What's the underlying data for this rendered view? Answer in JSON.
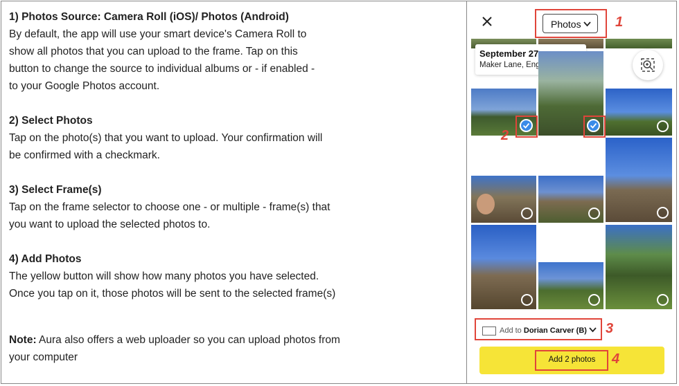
{
  "instructions": [
    {
      "title": "1) Photos Source: Camera Roll (iOS)/ Photos (Android)",
      "body": "By default, the app will use your smart device's Camera Roll to\nshow all photos that you can upload to the frame. Tap on this\nbutton to change the source to individual albums or - if enabled -\nto your Google Photos account."
    },
    {
      "title": "2) Select Photos",
      "body": "Tap on the photo(s) that you want to upload. Your confirmation will\nbe confirmed with a checkmark."
    },
    {
      "title": "3) Select Frame(s)",
      "body": "Tap on the frame selector to choose one - or multiple - frame(s) that\nyou want to upload the selected photos to."
    },
    {
      "title": "4) Add Photos",
      "body": "The yellow button will show how many photos you have selected.\nOnce you tap on it, those photos will be sent to the selected frame(s)"
    }
  ],
  "note": {
    "label": "Note:",
    "text": " Aura also offers a web uploader so you can upload photos from\nyour computer"
  },
  "phone": {
    "source_label": "Photos",
    "date": "September 27",
    "location": "Maker Lane, England",
    "add_prefix": "Add to",
    "frame_name": "Dorian Carver (B)",
    "add_button": "Add 2 photos"
  },
  "callouts": [
    "1",
    "2",
    "2",
    "3",
    "4"
  ],
  "colors": {
    "accent_yellow": "#f6e437",
    "callout_red": "#e0453a",
    "check_blue": "#3a8be8"
  }
}
